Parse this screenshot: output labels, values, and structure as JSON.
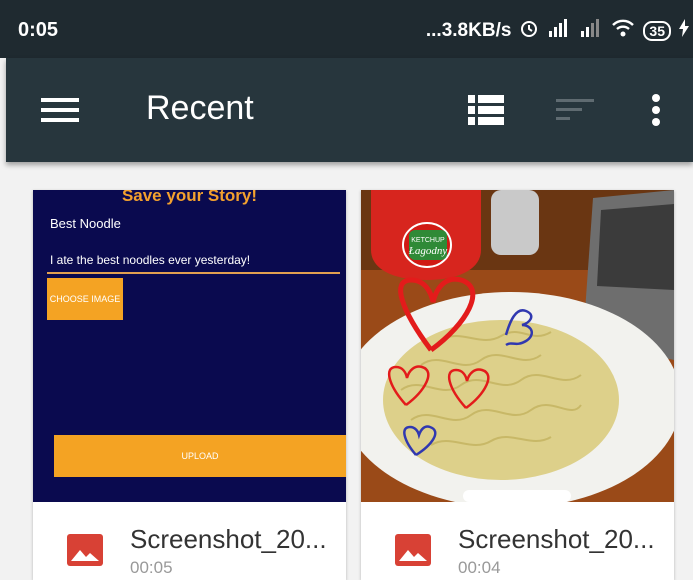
{
  "status_bar": {
    "time": "0:05",
    "network_speed": "...3.8KB/s",
    "battery": "35",
    "icons": [
      "alarm-icon",
      "signal-icon",
      "signal-icon",
      "wifi-icon",
      "battery-icon",
      "charging-icon"
    ]
  },
  "app_bar": {
    "title": "Recent",
    "menu_icon": "hamburger-menu-icon",
    "view_icon": "list-view-icon",
    "sort_icon": "sort-icon",
    "overflow_icon": "more-vert-icon",
    "background": "#27363d"
  },
  "files": [
    {
      "name": "Screenshot_20...",
      "time": "00:05",
      "icon": "image-file-icon",
      "thumbnail": {
        "heading": "Save your Story!",
        "title_field": "Best Noodle",
        "story_field": "I ate the best noodles ever yesterday!",
        "choose_button": "CHOOSE IMAGE",
        "upload_button": "UPLOAD"
      }
    },
    {
      "name": "Screenshot_20...",
      "time": "00:04",
      "icon": "image-file-icon",
      "thumbnail": {
        "bottle_label": "KETCHUP",
        "bottle_brand": "Łagodny"
      }
    }
  ],
  "colors": {
    "accent_orange": "#f4a323",
    "file_icon_red": "#d84135"
  }
}
